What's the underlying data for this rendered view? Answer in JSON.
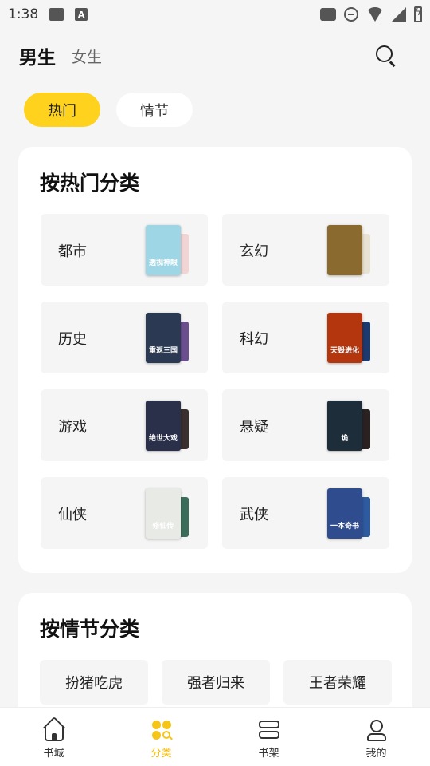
{
  "status_bar": {
    "time": "1:38",
    "text_icon": "A"
  },
  "header": {
    "tabs": [
      {
        "label": "男生",
        "active": true
      },
      {
        "label": "女生",
        "active": false
      }
    ]
  },
  "filters": [
    {
      "label": "热门",
      "active": true
    },
    {
      "label": "情节",
      "active": false
    }
  ],
  "hot_section": {
    "title": "按热门分类",
    "categories": [
      {
        "label": "都市",
        "front_cover_text": "透视神眼",
        "front_color": "#9fd6e6",
        "back_color": "#f1d4d4"
      },
      {
        "label": "玄幻",
        "front_cover_text": "",
        "front_color": "#8a6a2e",
        "back_color": "#e8e2d4"
      },
      {
        "label": "历史",
        "front_cover_text": "重返三国",
        "front_color": "#2b3a52",
        "back_color": "#6a4e8e"
      },
      {
        "label": "科幻",
        "front_cover_text": "天毁进化",
        "front_color": "#b3360f",
        "back_color": "#1c3a6e"
      },
      {
        "label": "游戏",
        "front_cover_text": "绝世大戏",
        "front_color": "#2a2f4a",
        "back_color": "#3a3030"
      },
      {
        "label": "悬疑",
        "front_cover_text": "诡",
        "front_color": "#1e2d3a",
        "back_color": "#2a2222"
      },
      {
        "label": "仙侠",
        "front_cover_text": "修仙传",
        "front_color": "#e8eae6",
        "back_color": "#3b6e5a"
      },
      {
        "label": "武侠",
        "front_cover_text": "一本奇书",
        "front_color": "#2e4c8e",
        "back_color": "#2e5aa0"
      }
    ]
  },
  "plot_section": {
    "title": "按情节分类",
    "tags": [
      "扮猪吃虎",
      "强者归来",
      "王者荣耀"
    ]
  },
  "bottom_nav": [
    {
      "label": "书城",
      "icon": "home-icon",
      "active": false
    },
    {
      "label": "分类",
      "icon": "category-icon",
      "active": true
    },
    {
      "label": "书架",
      "icon": "bookshelf-icon",
      "active": false
    },
    {
      "label": "我的",
      "icon": "profile-icon",
      "active": false
    }
  ],
  "colors": {
    "accent": "#ffd21e",
    "active_nav": "#f5b800",
    "background": "#f5f5f5"
  }
}
